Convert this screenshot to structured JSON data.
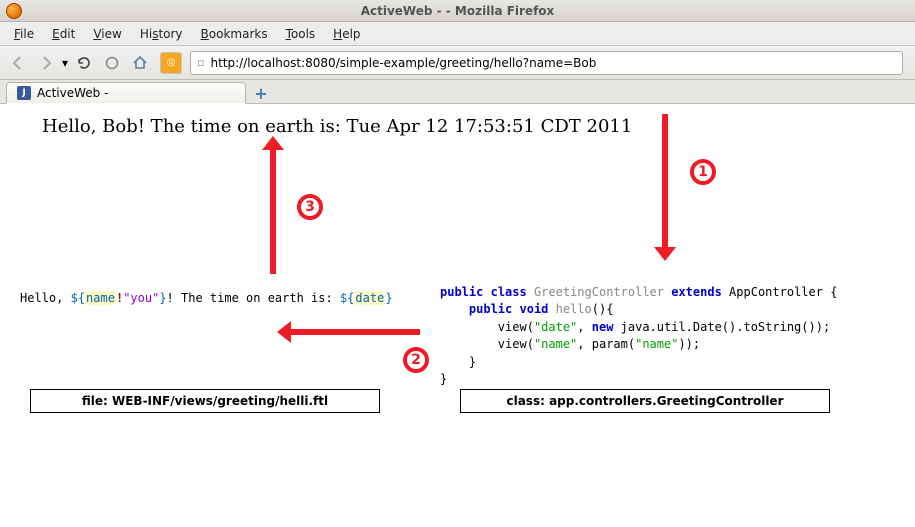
{
  "window": {
    "title": "ActiveWeb - - Mozilla Firefox"
  },
  "menu": {
    "file": "File",
    "edit": "Edit",
    "view": "View",
    "history": "History",
    "bookmarks": "Bookmarks",
    "tools": "Tools",
    "help": "Help"
  },
  "toolbar": {
    "url": "http://localhost:8080/simple-example/greeting/hello?name=Bob"
  },
  "tab": {
    "title": "ActiveWeb -",
    "newtab_label": "+"
  },
  "page": {
    "rendered_output": "Hello, Bob! The time on earth is: Tue Apr 12 17:53:51 CDT 2011"
  },
  "badges": {
    "b1": "1",
    "b2": "2",
    "b3": "3"
  },
  "template": {
    "t1": "Hello, ",
    "dollar": "$",
    "lbrace": "{",
    "name_var": "name",
    "bang": "!",
    "default_str": "\"you\"",
    "rbrace": "}",
    "t2": "! The time on earth is: ",
    "date_var": "date"
  },
  "java": {
    "kw_public": "public",
    "kw_class": "class",
    "cls_name": "GreetingController",
    "kw_extends": "extends",
    "super_cls": "AppController",
    "lbrace": " {",
    "indent1": "    ",
    "kw_void": " void",
    "mth_hello": "hello",
    "mth_sig_after": "(){",
    "indent2": "        ",
    "call_view": "view",
    "str_date": "\"date\"",
    "kw_new": "new",
    "date_expr": " java.util.Date().toString());",
    "str_name": "\"name\"",
    "param_call": ", param(",
    "param_close": "));",
    "rbrace1": "    }",
    "rbrace2": "}"
  },
  "captions": {
    "file": "file: WEB-INF/views/greeting/helli.ftl",
    "class": "class: app.controllers.GreetingController"
  }
}
